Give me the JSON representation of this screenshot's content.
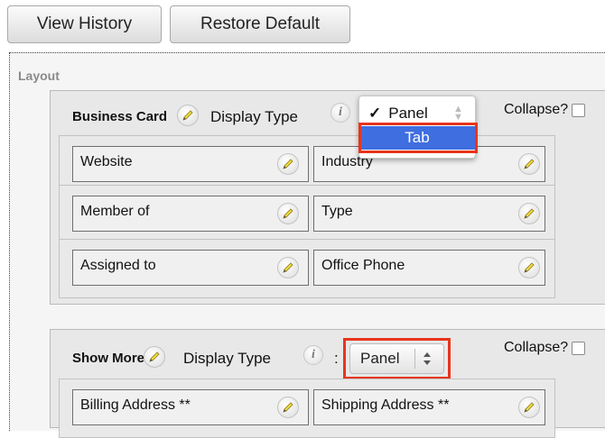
{
  "toolbar": {
    "view_history": "View History",
    "restore_default": "Restore Default"
  },
  "layout": {
    "label": "Layout"
  },
  "panels": [
    {
      "name": "Business Card",
      "display_type_label": "Display Type",
      "collapse_label": "Collapse?",
      "dropdown": {
        "options": [
          "Panel",
          "Tab"
        ],
        "checked": "Panel",
        "highlighted": "Tab"
      },
      "rows": [
        [
          "Website",
          "Industry"
        ],
        [
          "Member of",
          "Type"
        ],
        [
          "Assigned to",
          "Office Phone"
        ]
      ]
    },
    {
      "name": "Show More",
      "display_type_label": "Display Type",
      "separator": ":",
      "select_value": "Panel",
      "collapse_label": "Collapse?",
      "rows": [
        [
          "Billing Address **",
          "Shipping Address **"
        ]
      ]
    }
  ],
  "icons": {
    "edit": "pencil-icon",
    "info": "info-icon",
    "check": "checkmark-icon",
    "select_arrows": "up-down-arrows-icon"
  },
  "colors": {
    "highlight": "#3f6ee0",
    "callout": "#e8341c"
  }
}
